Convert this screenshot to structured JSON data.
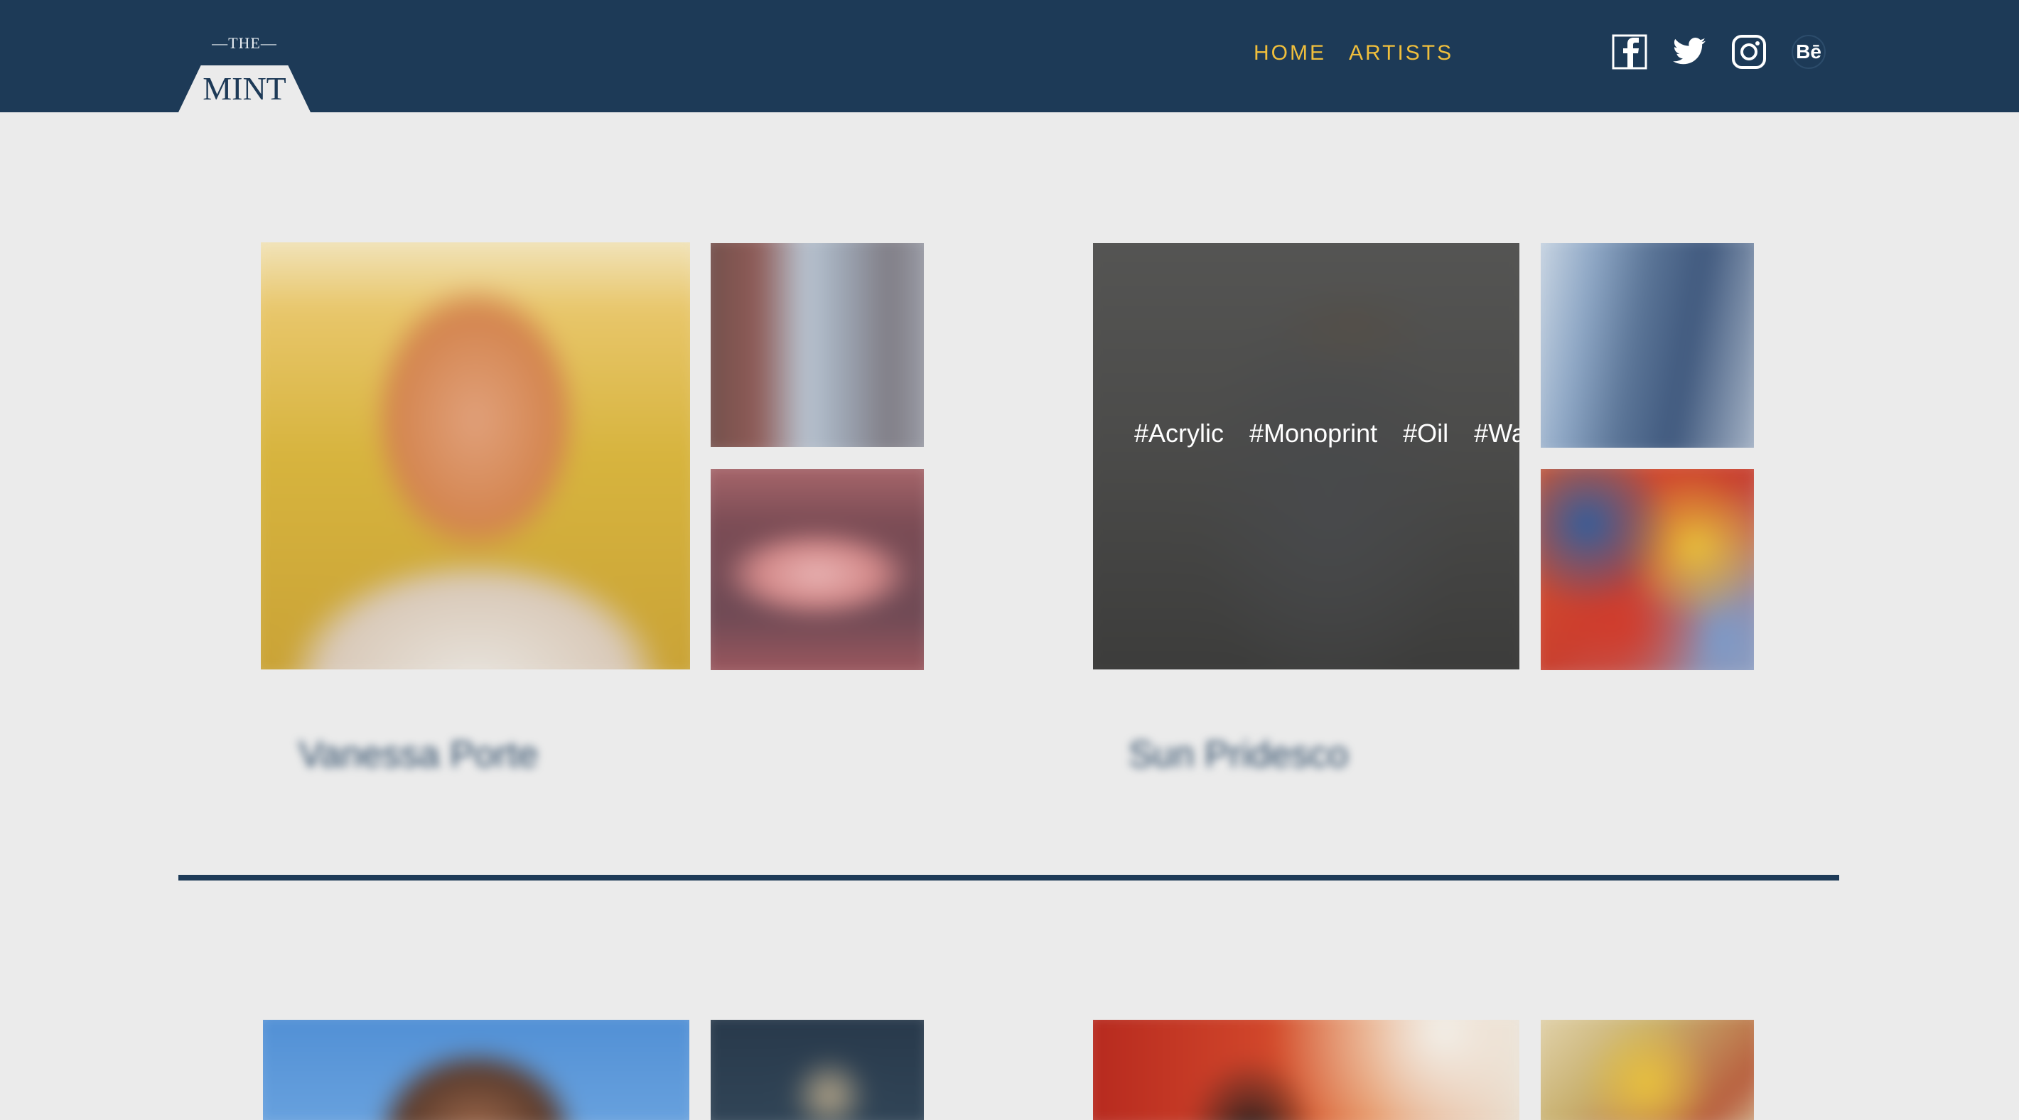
{
  "header": {
    "logo_top": "—THE—",
    "logo_main": "MINT",
    "nav": [
      {
        "label": "HOME"
      },
      {
        "label": "ARTISTS"
      }
    ],
    "social_icons": [
      "facebook-icon",
      "twitter-icon",
      "instagram-icon",
      "behance-icon"
    ],
    "behance_text": "Bē"
  },
  "colors": {
    "header_bg": "#1d3a57",
    "nav_text": "#f0bf3c",
    "page_bg": "#ebebeb"
  },
  "artists": [
    {
      "name": "Vanessa Porte"
    },
    {
      "name": "Sun Pridesco",
      "tags": [
        "#Acrylic",
        "#Monoprint",
        "#Oil",
        "#Watercolor"
      ]
    },
    {
      "name": ""
    },
    {
      "name": ""
    }
  ]
}
